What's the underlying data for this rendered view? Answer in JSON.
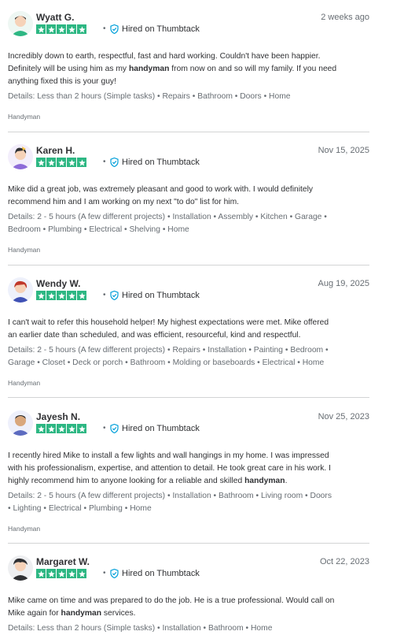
{
  "reviews": [
    {
      "avatar": "avatar-green-person",
      "name": "Wyatt G.",
      "date": "2 weeks ago",
      "rating": 5,
      "hired_label": "Hired on Thumbtack",
      "lines": [
        [
          "Incredibly down to earth, respectful, fast and hard working. Couldn't have been happier."
        ],
        [
          "Definitely will be using him as my ",
          {
            "b": "handyman"
          },
          " from now on and so will my family. If you need"
        ],
        [
          "anything fixed this is your guy!"
        ]
      ],
      "details": [
        "Details: Less than 2 hours (Simple tasks) • Repairs • Bathroom • Doors • Home"
      ],
      "category": "Handyman"
    },
    {
      "avatar": "avatar-purple-person",
      "name": "Karen H.",
      "date": "Nov 15, 2025",
      "rating": 5,
      "hired_label": "Hired on Thumbtack",
      "lines": [
        [
          "Mike did a great job, was extremely pleasant and good to work with. I would definitely"
        ],
        [
          "recommend him and I am working on my next \"to do\" list for him."
        ]
      ],
      "details": [
        "Details: 2 - 5 hours (A few different projects) • Installation • Assembly • Kitchen • Garage •",
        "Bedroom • Plumbing • Electrical • Shelving • Home"
      ],
      "category": "Handyman"
    },
    {
      "avatar": "avatar-blue-person",
      "name": "Wendy W.",
      "date": "Aug 19, 2025",
      "rating": 5,
      "hired_label": "Hired on Thumbtack",
      "lines": [
        [
          "I can't wait to refer this household helper! My highest expectations were met. Mike offered"
        ],
        [
          "an earlier date than scheduled, and was efficient, resourceful, kind and respectful."
        ]
      ],
      "details": [
        "Details: 2 - 5 hours (A few different projects) • Repairs • Installation • Painting • Bedroom •",
        "Garage • Closet • Deck or porch • Bathroom • Molding or baseboards • Electrical • Home"
      ],
      "category": "Handyman"
    },
    {
      "avatar": "avatar-indigo-person",
      "name": "Jayesh N.",
      "date": "Nov 25, 2023",
      "rating": 5,
      "hired_label": "Hired on Thumbtack",
      "lines": [
        [
          "I recently hired Mike to install a few lights and wall hangings in my home. I was impressed"
        ],
        [
          "with his professionalism, expertise, and attention to detail. He took great care in his work. I"
        ],
        [
          "highly recommend him to anyone looking for a reliable and skilled ",
          {
            "b": "handyman"
          },
          "."
        ]
      ],
      "details": [
        "Details: 2 - 5 hours (A few different projects) • Installation • Bathroom • Living room • Doors",
        "• Lighting • Electrical • Plumbing • Home"
      ],
      "category": "Handyman"
    },
    {
      "avatar": "avatar-dark-person",
      "name": "Margaret W.",
      "date": "Oct 22, 2023",
      "rating": 5,
      "hired_label": "Hired on Thumbtack",
      "lines": [
        [
          "Mike came on time and was prepared to do the job. He is a true professional. Would call on"
        ],
        [
          "Mike again for ",
          {
            "b": "handyman"
          },
          " services."
        ]
      ],
      "details": [
        "Details: Less than 2 hours (Simple tasks) • Installation • Bathroom • Home"
      ],
      "category": ""
    }
  ],
  "colors": {
    "star_green": "#2db783",
    "verified_blue": "#009fd9",
    "divider": "#d3d4d5",
    "muted_text": "#676d73",
    "body_text": "#2f3033"
  }
}
